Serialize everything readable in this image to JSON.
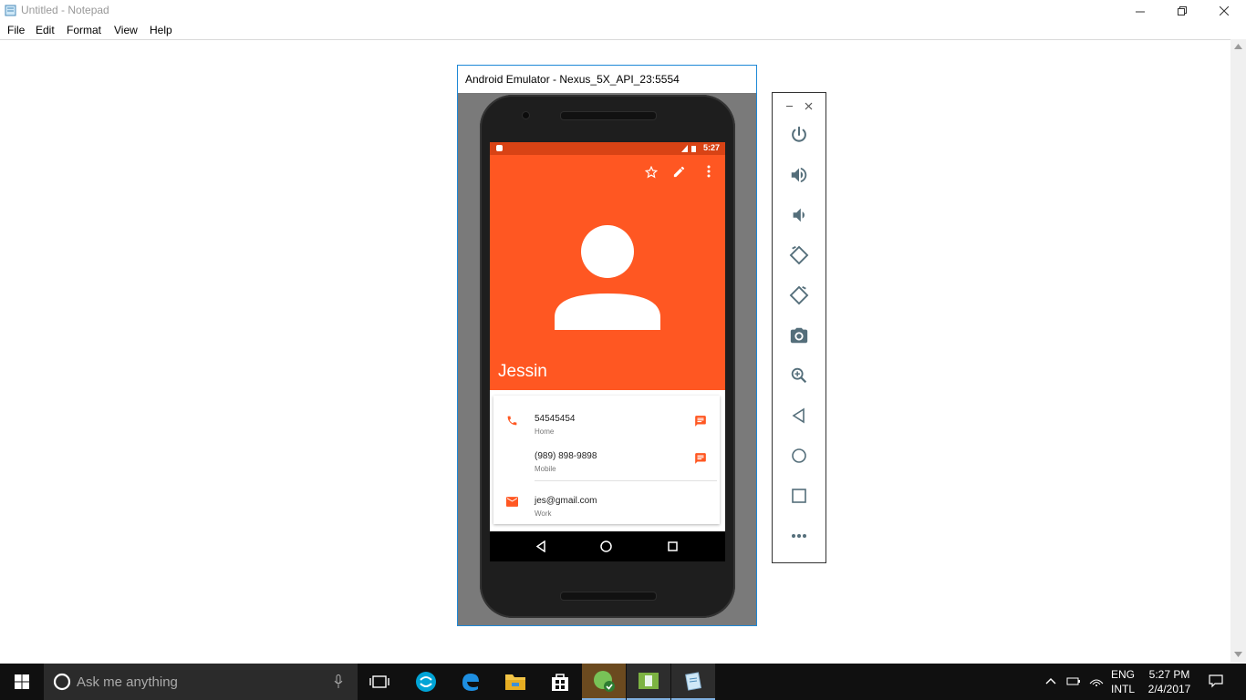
{
  "notepad": {
    "title": "Untitled - Notepad",
    "menu": [
      "File",
      "Edit",
      "Format",
      "View",
      "Help"
    ]
  },
  "emulator": {
    "title": "Android Emulator - Nexus_5X_API_23:5554",
    "status_time": "5:27",
    "contact": {
      "name": "Jessin",
      "rows": [
        {
          "value": "54545454",
          "type": "Home",
          "icon": "phone-icon"
        },
        {
          "value": "(989) 898-9898",
          "type": "Mobile",
          "icon": "message-icon"
        },
        {
          "value": "jes@gmail.com",
          "type": "Work",
          "icon": "email-icon"
        }
      ]
    },
    "accent_color": "#ff5722",
    "status_color": "#d84315"
  },
  "toolbar": {
    "buttons": [
      "power-icon",
      "volume-up-icon",
      "volume-down-icon",
      "rotate-left-icon",
      "rotate-right-icon",
      "camera-icon",
      "zoom-icon",
      "back-icon",
      "home-icon",
      "overview-icon",
      "more-icon"
    ]
  },
  "taskbar": {
    "search_placeholder": "Ask me anything",
    "lang_line1": "ENG",
    "lang_line2": "INTL",
    "time": "5:27 PM",
    "date": "2/4/2017"
  }
}
